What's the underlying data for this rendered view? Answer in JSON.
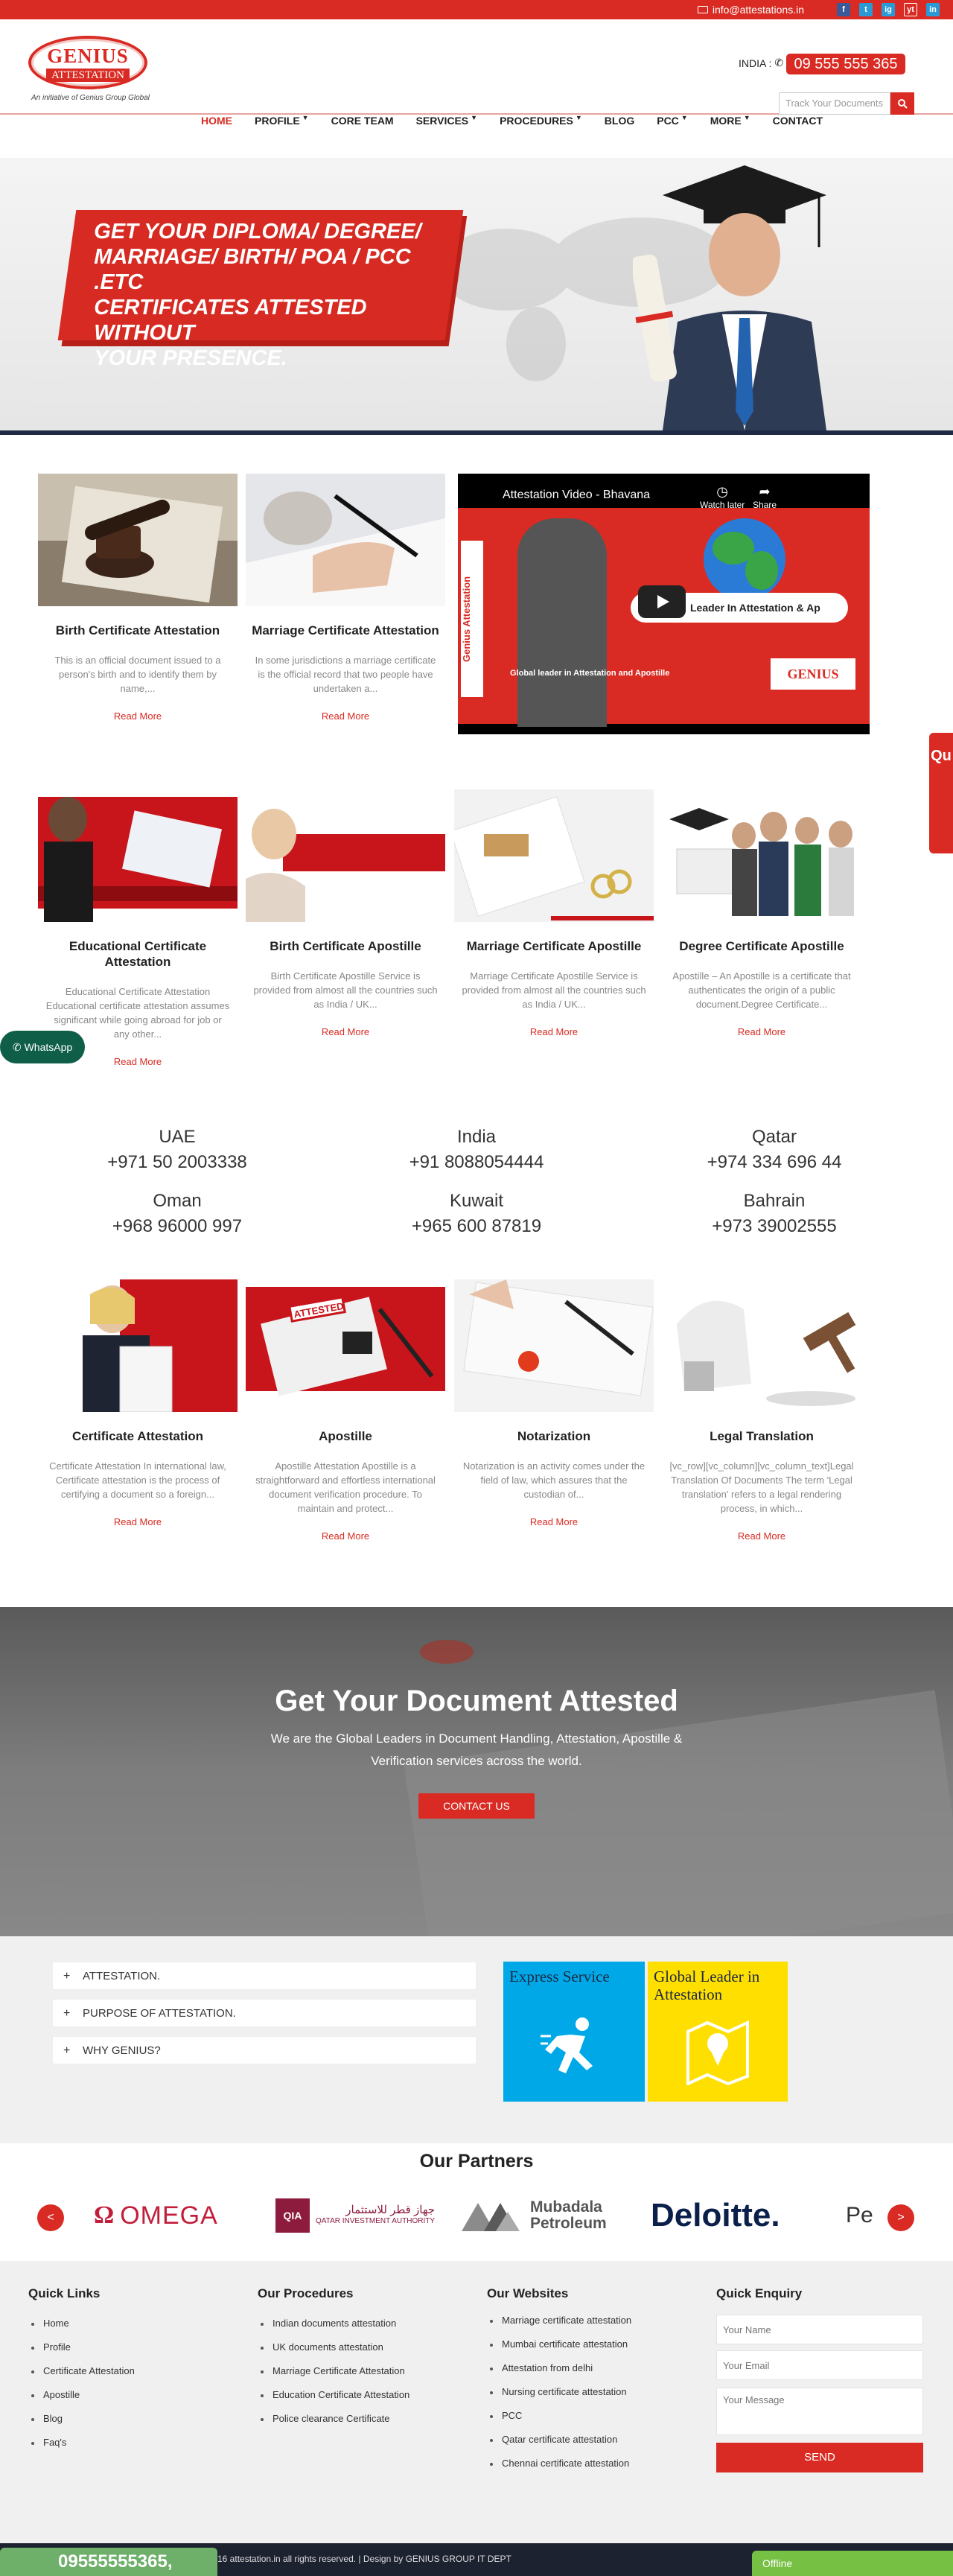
{
  "topbar": {
    "email": "info@attestations.in",
    "social": [
      "f",
      "t",
      "ig",
      "yt",
      "in"
    ]
  },
  "header": {
    "logo_genius": "GENIUS",
    "logo_attestation": "ATTESTATION",
    "logo_sub": "An initiative of Genius Group Global",
    "country": "INDIA :",
    "phone": "09 555 555 365",
    "track_placeholder": "Track Your Documents",
    "nav": [
      {
        "label": "HOME",
        "active": true,
        "dropdown": false
      },
      {
        "label": "PROFILE",
        "dropdown": true
      },
      {
        "label": "CORE TEAM",
        "dropdown": false
      },
      {
        "label": "SERVICES",
        "dropdown": true
      },
      {
        "label": "PROCEDURES",
        "dropdown": true
      },
      {
        "label": "BLOG",
        "dropdown": false
      },
      {
        "label": "PCC",
        "dropdown": true
      },
      {
        "label": "MORE",
        "dropdown": true
      },
      {
        "label": "CONTACT",
        "dropdown": false
      }
    ]
  },
  "banner": {
    "line1": "GET YOUR DIPLOMA/ DEGREE/",
    "line2": "MARRIAGE/ BIRTH/ POA / PCC .ETC",
    "line3": "CERTIFICATES ATTESTED WITHOUT",
    "line4": "YOUR PRESENCE."
  },
  "row1": [
    {
      "title": "Birth Certificate Attestation",
      "desc": "This is an official document issued to a person's birth and to identify them by name,...",
      "more": "Read More"
    },
    {
      "title": "Marriage Certificate Attestation",
      "desc": "In some jurisdictions a marriage certificate is the official record that two people have undertaken a...",
      "more": "Read More"
    }
  ],
  "video": {
    "title": "Attestation Video - Bhavana",
    "watch": "Watch later",
    "share": "Share",
    "side": "Genius Attestation",
    "tag": "Leader In Attestation & Ap",
    "bottom": "Global leader in Attestation and Apostille",
    "logo": "GENIUS"
  },
  "quick_tab": "Qu",
  "whatsapp": "WhatsApp",
  "row2": [
    {
      "title": "Educational Certificate Attestation",
      "desc": "Educational Certificate Attestation Educational certificate attestation assumes significant while going abroad for job or any other...",
      "more": "Read More"
    },
    {
      "title": "Birth Certificate Apostille",
      "desc": "Birth Certificate Apostille Service is provided from almost all the countries such as India / UK...",
      "more": "Read More"
    },
    {
      "title": "Marriage Certificate Apostille",
      "desc": "Marriage Certificate Apostille Service is provided from almost all the countries such as India / UK...",
      "more": "Read More"
    },
    {
      "title": "Degree Certificate Apostille",
      "desc": "Apostille – An Apostille is a certificate that authenticates the origin of a public document.Degree Certificate...",
      "more": "Read More"
    }
  ],
  "countries": [
    {
      "name": "UAE",
      "num": "+971 50 2003338"
    },
    {
      "name": "India",
      "num": "+91 8088054444"
    },
    {
      "name": "Qatar",
      "num": "+974 334 696 44"
    },
    {
      "name": "Oman",
      "num": "+968 96000 997"
    },
    {
      "name": "Kuwait",
      "num": "+965 600 87819"
    },
    {
      "name": "Bahrain",
      "num": "+973 39002555"
    }
  ],
  "row3": [
    {
      "title": "Certificate Attestation",
      "desc": "Certificate Attestation In international law, Certificate attestation  is the process of certifying a document so a foreign...",
      "more": "Read More"
    },
    {
      "title": "Apostille",
      "desc": "Apostille Attestation Apostille is a straightforward and effortless international document verification procedure. To maintain and protect...",
      "more": "Read More"
    },
    {
      "title": "Notarization",
      "desc": "Notarization is an activity comes under the field of law, which assures that the custodian of...",
      "more": "Read More"
    },
    {
      "title": "Legal Translation",
      "desc": "[vc_row][vc_column][vc_column_text]Legal Translation Of Documents The term 'Legal translation' refers to a legal rendering process, in which...",
      "more": "Read More"
    }
  ],
  "cta": {
    "title": "Get Your Document Attested",
    "text": "We are the Global Leaders in Document Handling, Attestation, Apostille & Verification services across the world.",
    "button": "CONTACT US"
  },
  "accordion": [
    "ATTESTATION.",
    "PURPOSE OF ATTESTATION.",
    "WHY GENIUS?"
  ],
  "express": "Express Service",
  "leader": "Global Leader in Attestation",
  "partners": {
    "title": "Our Partners",
    "logos": [
      "OMEGA",
      "QIA",
      "Mubadala Petroleum",
      "Deloitte.",
      "Pe"
    ],
    "qia_arabic": "جهاز قطر للاستثمار",
    "qia_english": "QATAR INVESTMENT AUTHORITY"
  },
  "footer": {
    "quick_links": {
      "title": "Quick Links",
      "items": [
        "Home",
        "Profile",
        "Certificate Attestation",
        "Apostille",
        "Blog",
        "Faq's"
      ]
    },
    "procedures": {
      "title": "Our Procedures",
      "items": [
        "Indian documents attestation",
        "UK documents attestation",
        "Marriage Certificate Attestation",
        "Education Certificate Attestation",
        "Police clearance Certificate"
      ]
    },
    "websites": {
      "title": "Our Websites",
      "items": [
        "Marriage certificate attestation",
        "Mumbai certificate attestation",
        "Attestation from delhi",
        "Nursing certificate attestation",
        "PCC",
        "Qatar certificate attestation",
        "Chennai certificate attestation"
      ]
    },
    "enquiry": {
      "title": "Quick Enquiry",
      "name": "Your Name",
      "email": "Your Email",
      "message": "Your Message",
      "send": "SEND"
    }
  },
  "bottom": {
    "call": "09555555365,",
    "copy": "16 attestation.in all rights reserved. | Design by GENIUS GROUP IT DEPT",
    "offline": "Offline"
  }
}
